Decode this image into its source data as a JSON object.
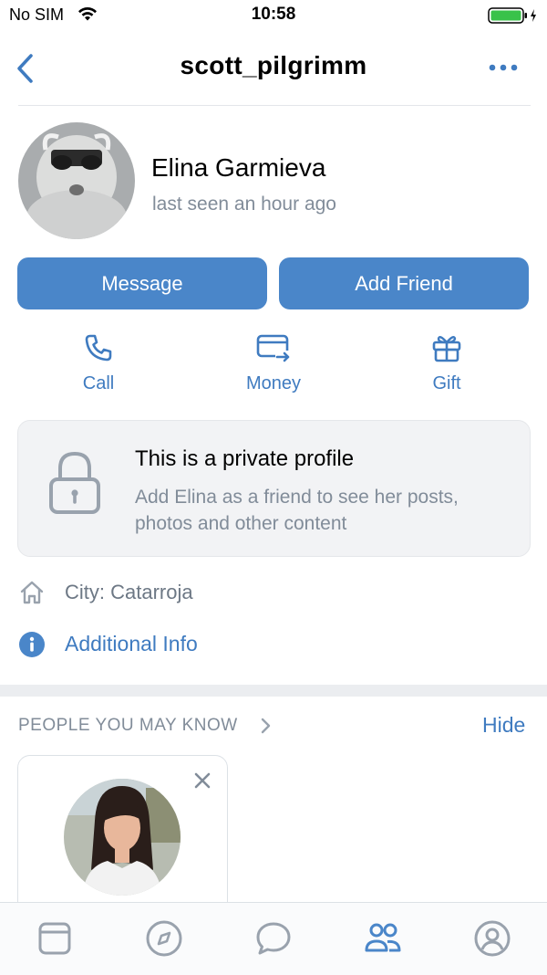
{
  "status_bar": {
    "carrier": "No SIM",
    "time": "10:58"
  },
  "header": {
    "title": "scott_pilgrimm"
  },
  "profile": {
    "name": "Elina Garmieva",
    "last_seen": "last seen an hour ago"
  },
  "buttons": {
    "message": "Message",
    "add_friend": "Add Friend"
  },
  "actions": [
    {
      "label": "Call",
      "icon": "phone-icon"
    },
    {
      "label": "Money",
      "icon": "money-transfer-icon"
    },
    {
      "label": "Gift",
      "icon": "gift-icon"
    }
  ],
  "private_profile": {
    "title": "This is a private profile",
    "text": "Add Elina as a friend to see her posts, photos and other content"
  },
  "details": {
    "city": "City: Catarroja",
    "additional_info": "Additional Info"
  },
  "people_you_may_know": {
    "title": "PEOPLE YOU MAY KNOW",
    "hide_label": "Hide"
  },
  "colors": {
    "accent": "#4a86c9",
    "link": "#3f7bc0",
    "muted": "#818c99"
  },
  "tabbar": {
    "active": "friends",
    "items": [
      "news-icon",
      "discover-icon",
      "messages-icon",
      "friends-icon",
      "profile-icon"
    ]
  }
}
